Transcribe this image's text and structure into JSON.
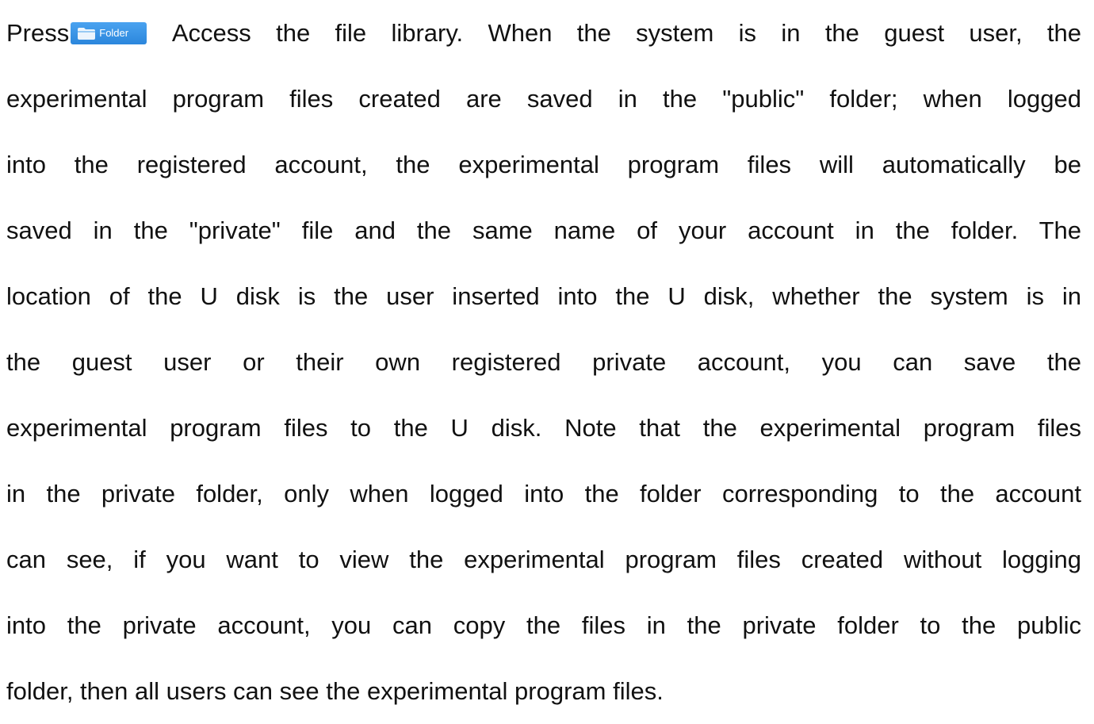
{
  "button": {
    "icon": "folder-icon",
    "label": "Folder",
    "color": "#3a95e6"
  },
  "paragraph": {
    "lines": [
      {
        "before": "Press",
        "after": " Access the file library. When the system is in the guest user, the"
      },
      "experimental program files created are saved in the \"public\" folder; when logged",
      "into the registered account, the experimental program files will automatically be",
      "saved in the \"private\" file and the same name of your account in the folder. The",
      "location of the U disk is the user inserted into the U disk, whether the system is in",
      "the guest user or their own registered private account, you can save the",
      "experimental program files to the U disk. Note that the experimental program files",
      "in the private folder, only when logged into the folder corresponding to the account",
      "can see, if you want to view the experimental program files created without logging",
      "into the private account, you can copy the files in the private folder to the public",
      "folder, then all users can see the experimental program files."
    ]
  }
}
